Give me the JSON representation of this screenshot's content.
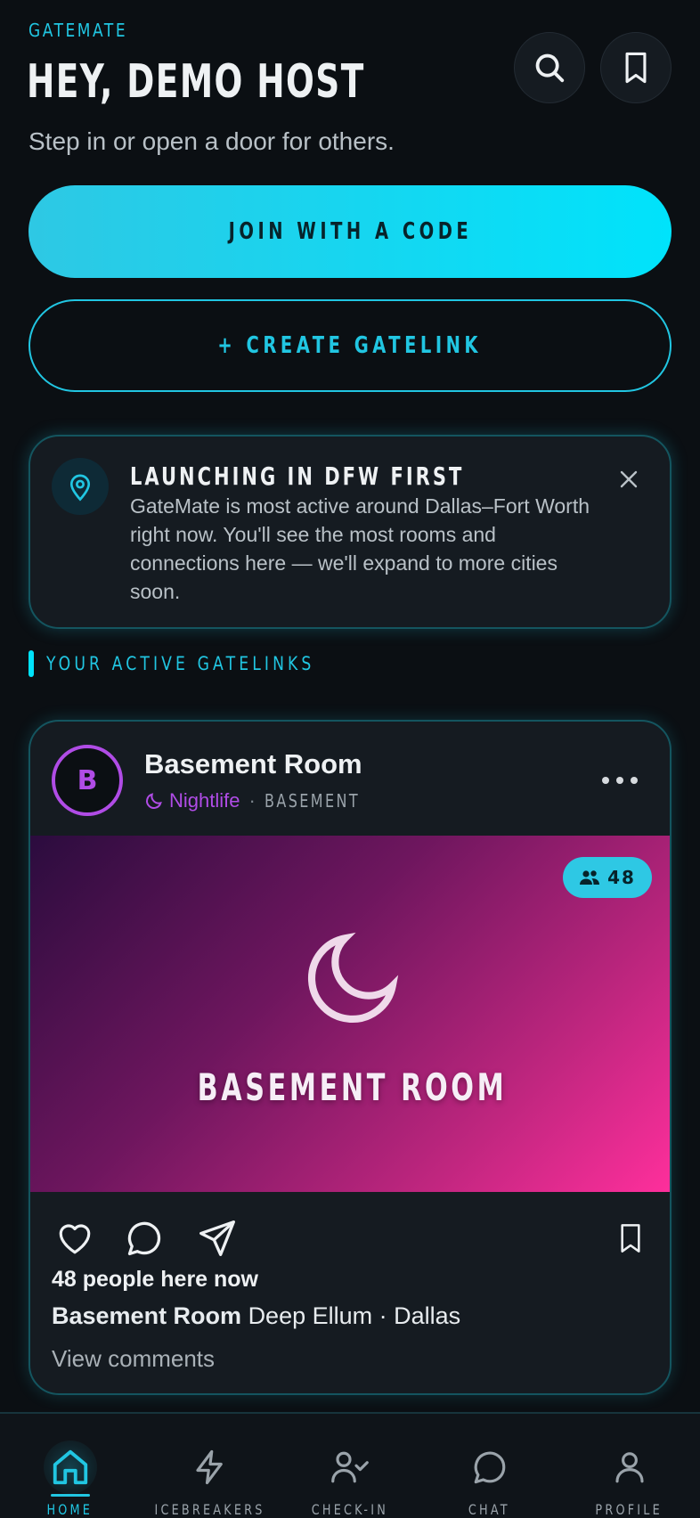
{
  "header": {
    "brand": "GATEMATE",
    "greeting": "HEY, DEMO HOST",
    "subtitle": "Step in or open a door for others."
  },
  "actions": {
    "join_label": "JOIN WITH A CODE",
    "create_label": "+ CREATE GATELINK"
  },
  "notice": {
    "title": "LAUNCHING IN DFW FIRST",
    "body": "GateMate is most active around Dallas–Fort Worth right now. You'll see the most rooms and connections here — we'll expand to more cities soon."
  },
  "section": {
    "label": "YOUR ACTIVE GATELINKS"
  },
  "card": {
    "avatar_letter": "B",
    "title": "Basement Room",
    "category": "Nightlife",
    "separator": "·",
    "place": "BASEMENT",
    "people_count": "48",
    "hero_title": "BASEMENT ROOM",
    "people_here": "48 people here now",
    "caption_name": "Basement Room",
    "caption_location": "Deep Ellum · Dallas",
    "view_comments": "View comments"
  },
  "tabs": [
    {
      "label": "HOME",
      "icon": "home-icon",
      "active": true
    },
    {
      "label": "ICEBREAKERS",
      "icon": "lightning-icon",
      "active": false
    },
    {
      "label": "CHECK-IN",
      "icon": "user-check-icon",
      "active": false
    },
    {
      "label": "CHAT",
      "icon": "chat-icon",
      "active": false
    },
    {
      "label": "PROFILE",
      "icon": "user-icon",
      "active": false
    }
  ],
  "colors": {
    "accent": "#21c6e2",
    "accent_bright": "#00e3fb",
    "background": "#0b0f13",
    "card": "#151b21",
    "nightlife": "#b04ce6",
    "hero_gradient_end": "#ff2f9c"
  }
}
